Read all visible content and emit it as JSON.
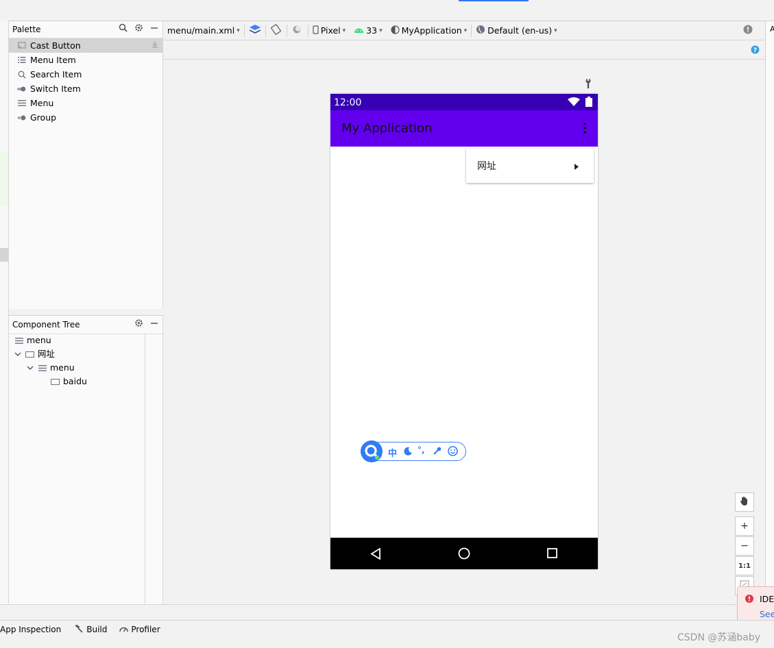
{
  "palette": {
    "title": "Palette",
    "items": [
      {
        "label": "Cast Button",
        "icon": "cast-icon"
      },
      {
        "label": "Menu Item",
        "icon": "list-icon"
      },
      {
        "label": "Search Item",
        "icon": "search-icon"
      },
      {
        "label": "Switch Item",
        "icon": "switch-icon"
      },
      {
        "label": "Menu",
        "icon": "menu-icon"
      },
      {
        "label": "Group",
        "icon": "group-icon"
      }
    ]
  },
  "tree": {
    "title": "Component Tree",
    "nodes": [
      {
        "label": "menu"
      },
      {
        "label": "网址"
      },
      {
        "label": "menu"
      },
      {
        "label": "baidu"
      }
    ]
  },
  "toolbar": {
    "file": "menu/main.xml",
    "device": "Pixel",
    "api": "33",
    "theme": "MyApplication",
    "locale": "Default (en-us)"
  },
  "phone": {
    "time": "12:00",
    "app_title": "My Application",
    "popup_item": "网址"
  },
  "ime": {
    "lang": "中",
    "punct": "°,"
  },
  "zoom": {
    "plus": "+",
    "minus": "−",
    "one_to_one": "1:1"
  },
  "bottom": {
    "items": [
      "App Inspection",
      "Build",
      "Profiler"
    ]
  },
  "notice": {
    "title": "IDE",
    "link": "See"
  },
  "watermark": "CSDN @苏涵baby",
  "right_col_letter": "A"
}
